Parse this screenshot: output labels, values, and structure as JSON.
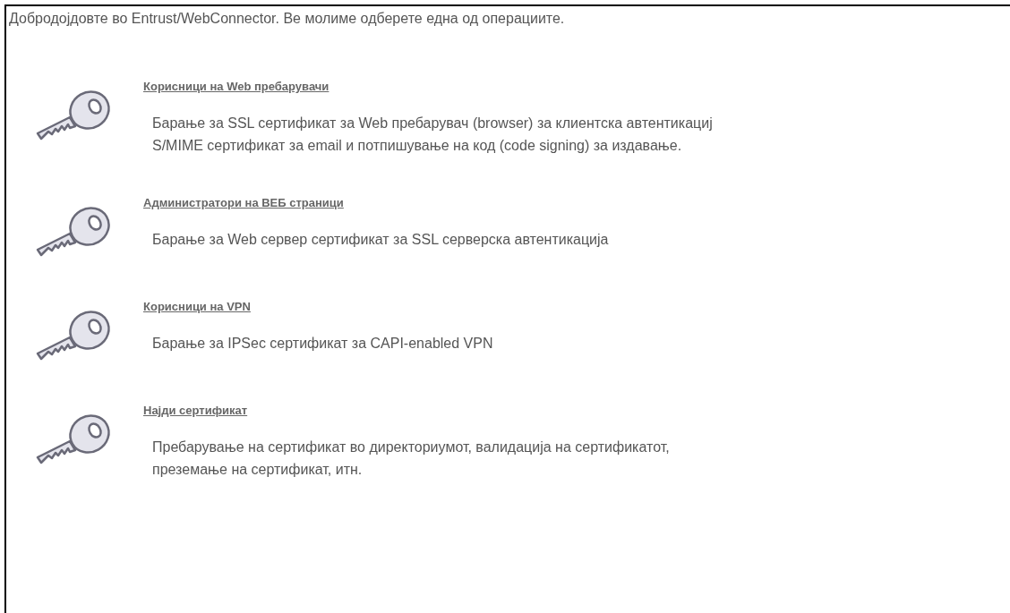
{
  "intro": "Добродојдовте во Entrust/WebConnector. Ве молиме одберете една од операциите.",
  "options": [
    {
      "title": "Корисници на Web пребарувачи",
      "lines": [
        "Барање за SSL сертификат за Web пребарувач (browser) за клиентска автентикациј",
        "S/MIME сертификат за email и потпишување на код (code signing) за издавање."
      ]
    },
    {
      "title": "Администратори на ВЕБ страници",
      "lines": [
        "Барање за Web сервер сертификат за SSL серверска автентикација"
      ]
    },
    {
      "title": "Корисници на VPN",
      "lines": [
        "Барање за IPSec сертификат за CAPI-enabled VPN"
      ]
    },
    {
      "title": "Најди сертификат",
      "lines": [
        "Пребарување на сертификат во директориумот, валидација на сертификатот,",
        "преземање на сертификат, итн."
      ]
    }
  ]
}
